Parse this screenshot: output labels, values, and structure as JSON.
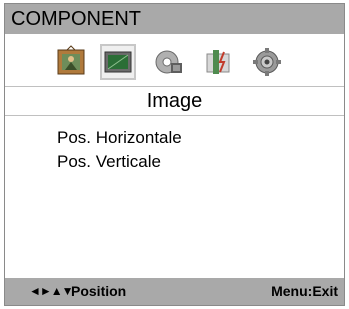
{
  "header": {
    "title": "COMPONENT"
  },
  "tabs": [
    {
      "icon": "picture-icon"
    },
    {
      "icon": "screen-icon",
      "selected": true
    },
    {
      "icon": "audio-icon"
    },
    {
      "icon": "setup-icon"
    },
    {
      "icon": "settings-gear-icon"
    }
  ],
  "section": {
    "title": "Image"
  },
  "menu": {
    "items": [
      {
        "label": "Pos. Horizontale"
      },
      {
        "label": "Pos. Verticale"
      }
    ]
  },
  "footer": {
    "arrows": "◄►▲▼",
    "hint": "Position",
    "exit": "Menu:Exit"
  },
  "colors": {
    "bar": "#a9a9a9",
    "background": "#ffffff"
  }
}
